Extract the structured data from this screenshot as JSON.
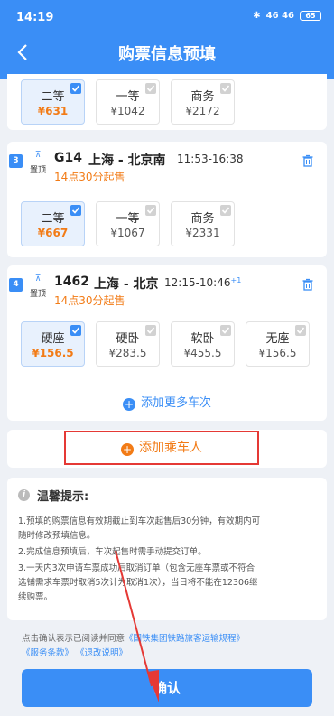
{
  "status": {
    "time": "14:19",
    "signal": "46 46",
    "battery": "65"
  },
  "nav": {
    "title": "购票信息预填"
  },
  "train0": {
    "seats": [
      {
        "name": "二等",
        "price": "¥631",
        "selected": true
      },
      {
        "name": "一等",
        "price": "¥1042",
        "selected": false
      },
      {
        "name": "商务",
        "price": "¥2172",
        "selected": false
      }
    ]
  },
  "train1": {
    "index": "3",
    "pin_icon": "⊼",
    "pin_label": "置顶",
    "number": "G14",
    "route": "上海 - 北京南",
    "times": "11:53-16:38",
    "sale": "14点30分起售",
    "seats": [
      {
        "name": "二等",
        "price": "¥667",
        "selected": true
      },
      {
        "name": "一等",
        "price": "¥1067",
        "selected": false
      },
      {
        "name": "商务",
        "price": "¥2331",
        "selected": false
      }
    ]
  },
  "train2": {
    "index": "4",
    "pin_icon": "⊼",
    "pin_label": "置顶",
    "number": "1462",
    "route": "上海 - 北京",
    "times": "12:15-10:46",
    "days": "+1",
    "sale": "14点30分起售",
    "seats": [
      {
        "name": "硬座",
        "price": "¥156.5",
        "selected": true
      },
      {
        "name": "硬卧",
        "price": "¥283.5",
        "selected": false
      },
      {
        "name": "软卧",
        "price": "¥455.5",
        "selected": false
      },
      {
        "name": "无座",
        "price": "¥156.5",
        "selected": false
      }
    ]
  },
  "add_train": "添加更多车次",
  "add_passenger": "添加乘车人",
  "tips": {
    "title": "温馨提示:",
    "lines": [
      "1.预填的购票信息有效期截止到车次起售后30分钟，有效期内可",
      "随时修改预填信息。",
      "2.完成信息预填后，车次起售时需手动提交订单。",
      "3.一天内3次申请车票成功后取消订单（包含无座车票或不符合",
      "选铺需求车票时取消5次计为取消1次），当日将不能在12306继",
      "续购票。"
    ]
  },
  "agreement": {
    "prefix": "点击确认表示已阅读并同意",
    "link1": "《国铁集团铁路旅客运输规程》",
    "link2": "《服务条款》",
    "link3": "《退改说明》"
  },
  "confirm": "确认",
  "colors": {
    "primary": "#3a8ef6",
    "orange": "#f27b16",
    "highlight": "#e53935"
  }
}
